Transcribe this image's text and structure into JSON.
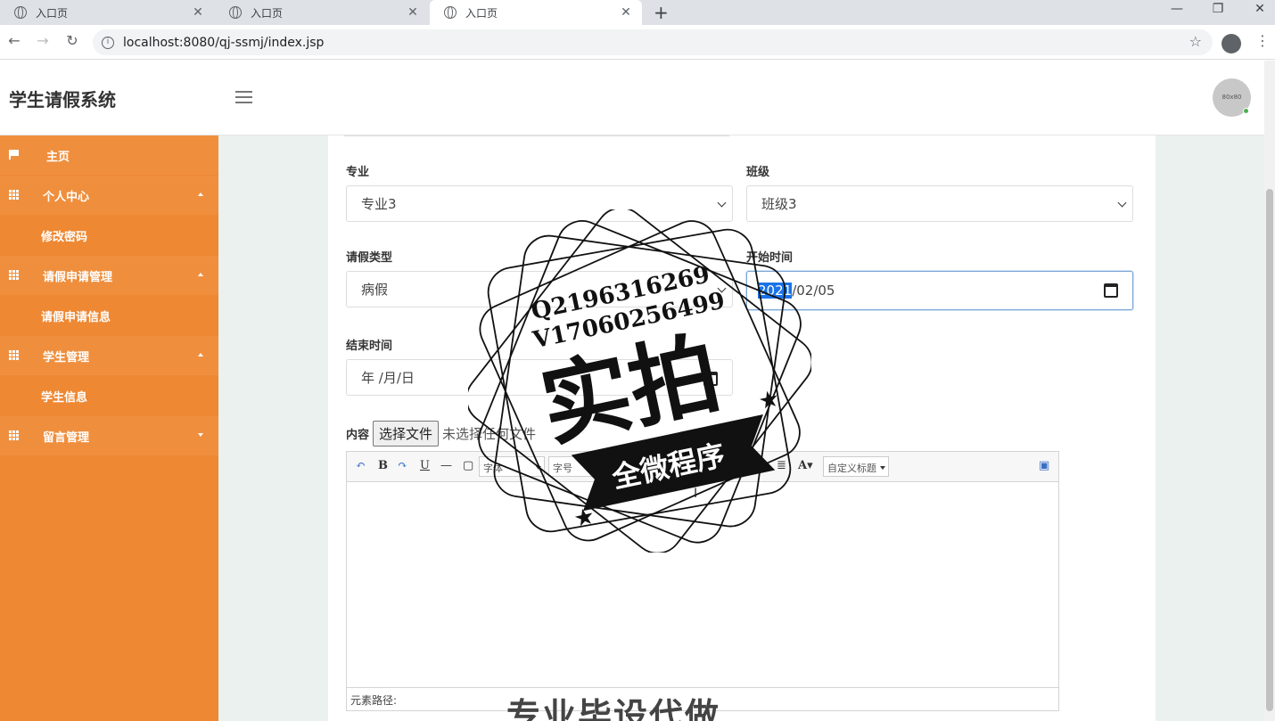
{
  "browser": {
    "tabs": [
      {
        "label": "入口页",
        "active": false
      },
      {
        "label": "入口页",
        "active": false
      },
      {
        "label": "入口页",
        "active": true
      }
    ],
    "url": "localhost:8080/qj-ssmj/index.jsp"
  },
  "header": {
    "title": "学生请假系统",
    "avatar_text": "80x80"
  },
  "sidebar": {
    "accent": "#ee8833",
    "items": [
      {
        "label": "主页",
        "icon": "flag-icon",
        "type": "top"
      },
      {
        "label": "个人中心",
        "icon": "grid-icon",
        "type": "top",
        "caret": "up"
      },
      {
        "label": "修改密码",
        "type": "sub"
      },
      {
        "label": "请假申请管理",
        "icon": "grid-icon",
        "type": "top",
        "caret": "up"
      },
      {
        "label": "请假申请信息",
        "type": "sub"
      },
      {
        "label": "学生管理",
        "icon": "grid-icon",
        "type": "top",
        "caret": "up"
      },
      {
        "label": "学生信息",
        "type": "sub"
      },
      {
        "label": "留言管理",
        "icon": "grid-icon",
        "type": "top",
        "caret": "down"
      }
    ]
  },
  "form": {
    "major_label": "专业",
    "major_value": "专业3",
    "class_label": "班级",
    "class_value": "班级3",
    "leave_type_label": "请假类型",
    "leave_type_value": "病假",
    "start_label": "开始时间",
    "start_year": "2021",
    "start_rest": "/02/05",
    "end_label": "结束时间",
    "end_placeholder": "年 /月/日",
    "content_label": "内容",
    "file_button": "选择文件",
    "file_status": "未选择任何文件"
  },
  "editor": {
    "font_family_placeholder": "字体",
    "font_size_placeholder": "字号",
    "custom_heading": "自定义标题",
    "path_label": "元素路径:"
  },
  "watermark": {
    "line1": "Q2196316269",
    "line2": "V17060256499",
    "big": "实拍",
    "banner": "全微程序",
    "bottom": "专业毕设代做"
  }
}
